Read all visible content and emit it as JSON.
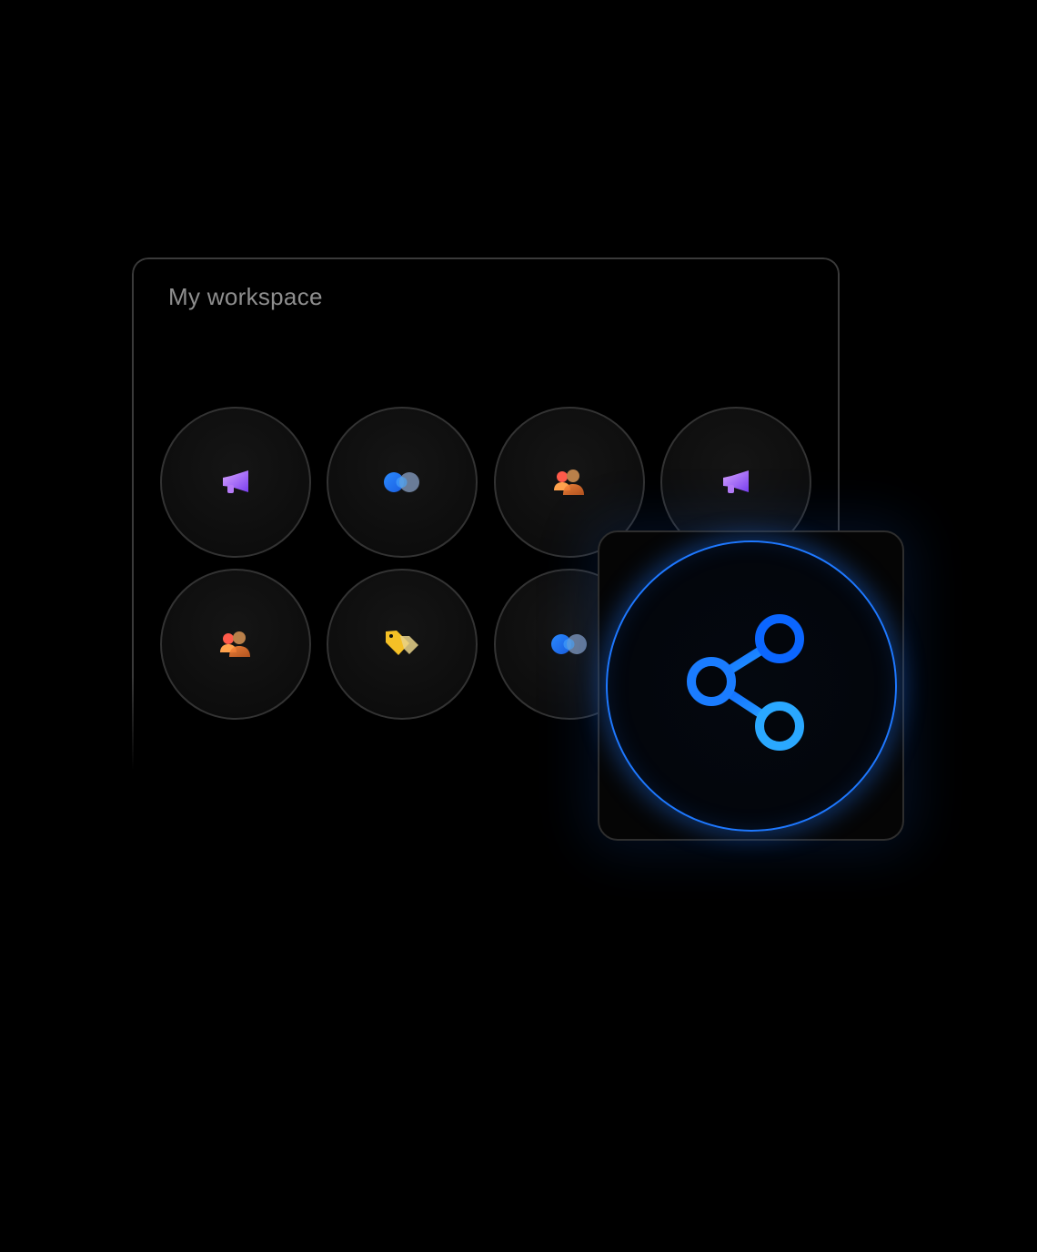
{
  "workspace": {
    "title": "My workspace"
  },
  "apps": [
    {
      "icon": "megaphone-icon",
      "color": "#a15cf5"
    },
    {
      "icon": "linked-circles-icon",
      "color": "#1c7cff"
    },
    {
      "icon": "people-icon",
      "color": "#f07a3a"
    },
    {
      "icon": "megaphone-icon",
      "color": "#a15cf5"
    },
    {
      "icon": "people-icon",
      "color": "#f07a3a"
    },
    {
      "icon": "tag-icon",
      "color": "#f5c026"
    },
    {
      "icon": "linked-circles-icon",
      "color": "#1c7cff"
    }
  ],
  "share": {
    "icon": "share-icon",
    "accent": "#1e78ff"
  }
}
